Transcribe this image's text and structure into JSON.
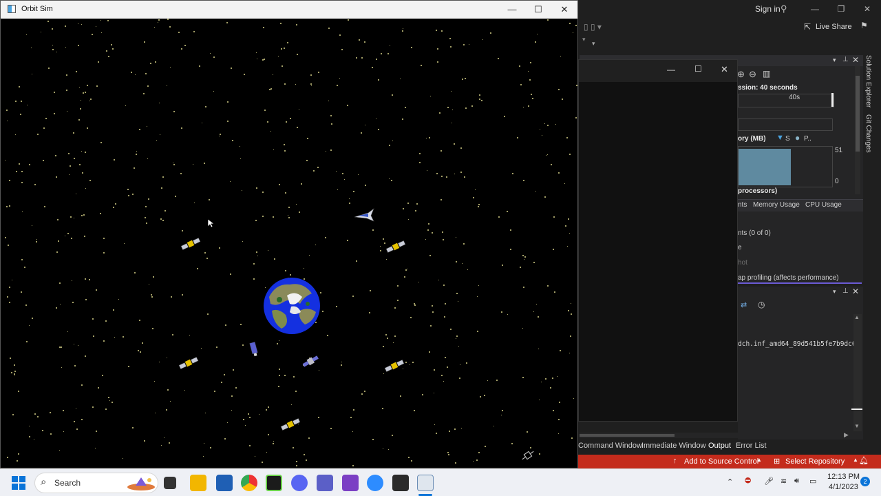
{
  "orbit_window": {
    "title": "Orbit Sim",
    "controls": {
      "minimize": "—",
      "maximize": "☐",
      "close": "✕"
    }
  },
  "vs": {
    "sign_in": "Sign in",
    "live_share": "Live Share",
    "side_tabs": [
      "Solution Explorer",
      "Git Changes"
    ],
    "diag": {
      "session": "ssion: 40 seconds",
      "timeline_label": "40s",
      "memory_label": "ory (MB)",
      "legend_s": "S",
      "legend_p": "P..",
      "mem_max": "51",
      "mem_min": "0",
      "cpu_label": "processors)",
      "tabs": [
        "nts",
        "Memory Usage",
        "CPU Usage"
      ],
      "events": "nts (0 of 0)",
      "row2": "e",
      "row3": "hot",
      "heap": "ap profiling (affects performance)"
    },
    "output_line": "dch.inf_amd64_89d541b5fe7b9dc6\\",
    "bottom_tabs": [
      "Command Window",
      "Immediate Window",
      "Output",
      "Error List"
    ],
    "status": {
      "source_control": "Add to Source Control",
      "repository": "Select Repository"
    }
  },
  "taskbar": {
    "search_label": "Search",
    "time": "12:13 PM",
    "date": "4/1/2023",
    "notification_count": "2"
  },
  "colors": {
    "accent_status": "#c42b1c",
    "space": "#000000",
    "stars": "#d9d48a"
  },
  "icons": [
    "windows-start-icon",
    "search-icon",
    "task-view-icon",
    "file-explorer-icon",
    "store-icon",
    "chrome-icon",
    "terminal-icon",
    "discord-icon",
    "teams-icon",
    "visual-studio-icon",
    "zoom-icon",
    "console-icon",
    "orbit-sim-icon"
  ]
}
